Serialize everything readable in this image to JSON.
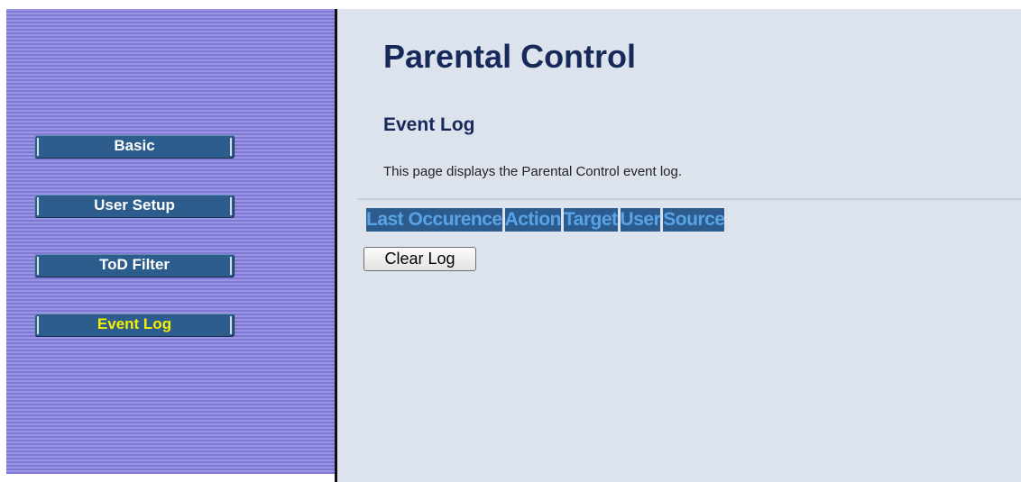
{
  "sidebar": {
    "items": [
      {
        "label": "Basic"
      },
      {
        "label": "User Setup"
      },
      {
        "label": "ToD Filter"
      },
      {
        "label": "Event Log",
        "active": true
      }
    ]
  },
  "main": {
    "title": "Parental Control",
    "section_title": "Event Log",
    "description": "This page displays the Parental Control event log.",
    "log_table": {
      "columns": [
        "Last Occurence",
        "Action",
        "Target",
        "User",
        "Source"
      ],
      "rows": []
    },
    "clear_button_label": "Clear Log"
  },
  "colors": {
    "sidebar_stripe_light": "#9b95e6",
    "sidebar_stripe_dark": "#7f78d3",
    "nav_button": "#2d5d8c",
    "nav_active_text": "#f3f000",
    "content_bg": "#dde3ec",
    "title_text": "#17295a",
    "table_header_bg": "#2c5b8d",
    "table_header_text": "#5aa3e6"
  }
}
